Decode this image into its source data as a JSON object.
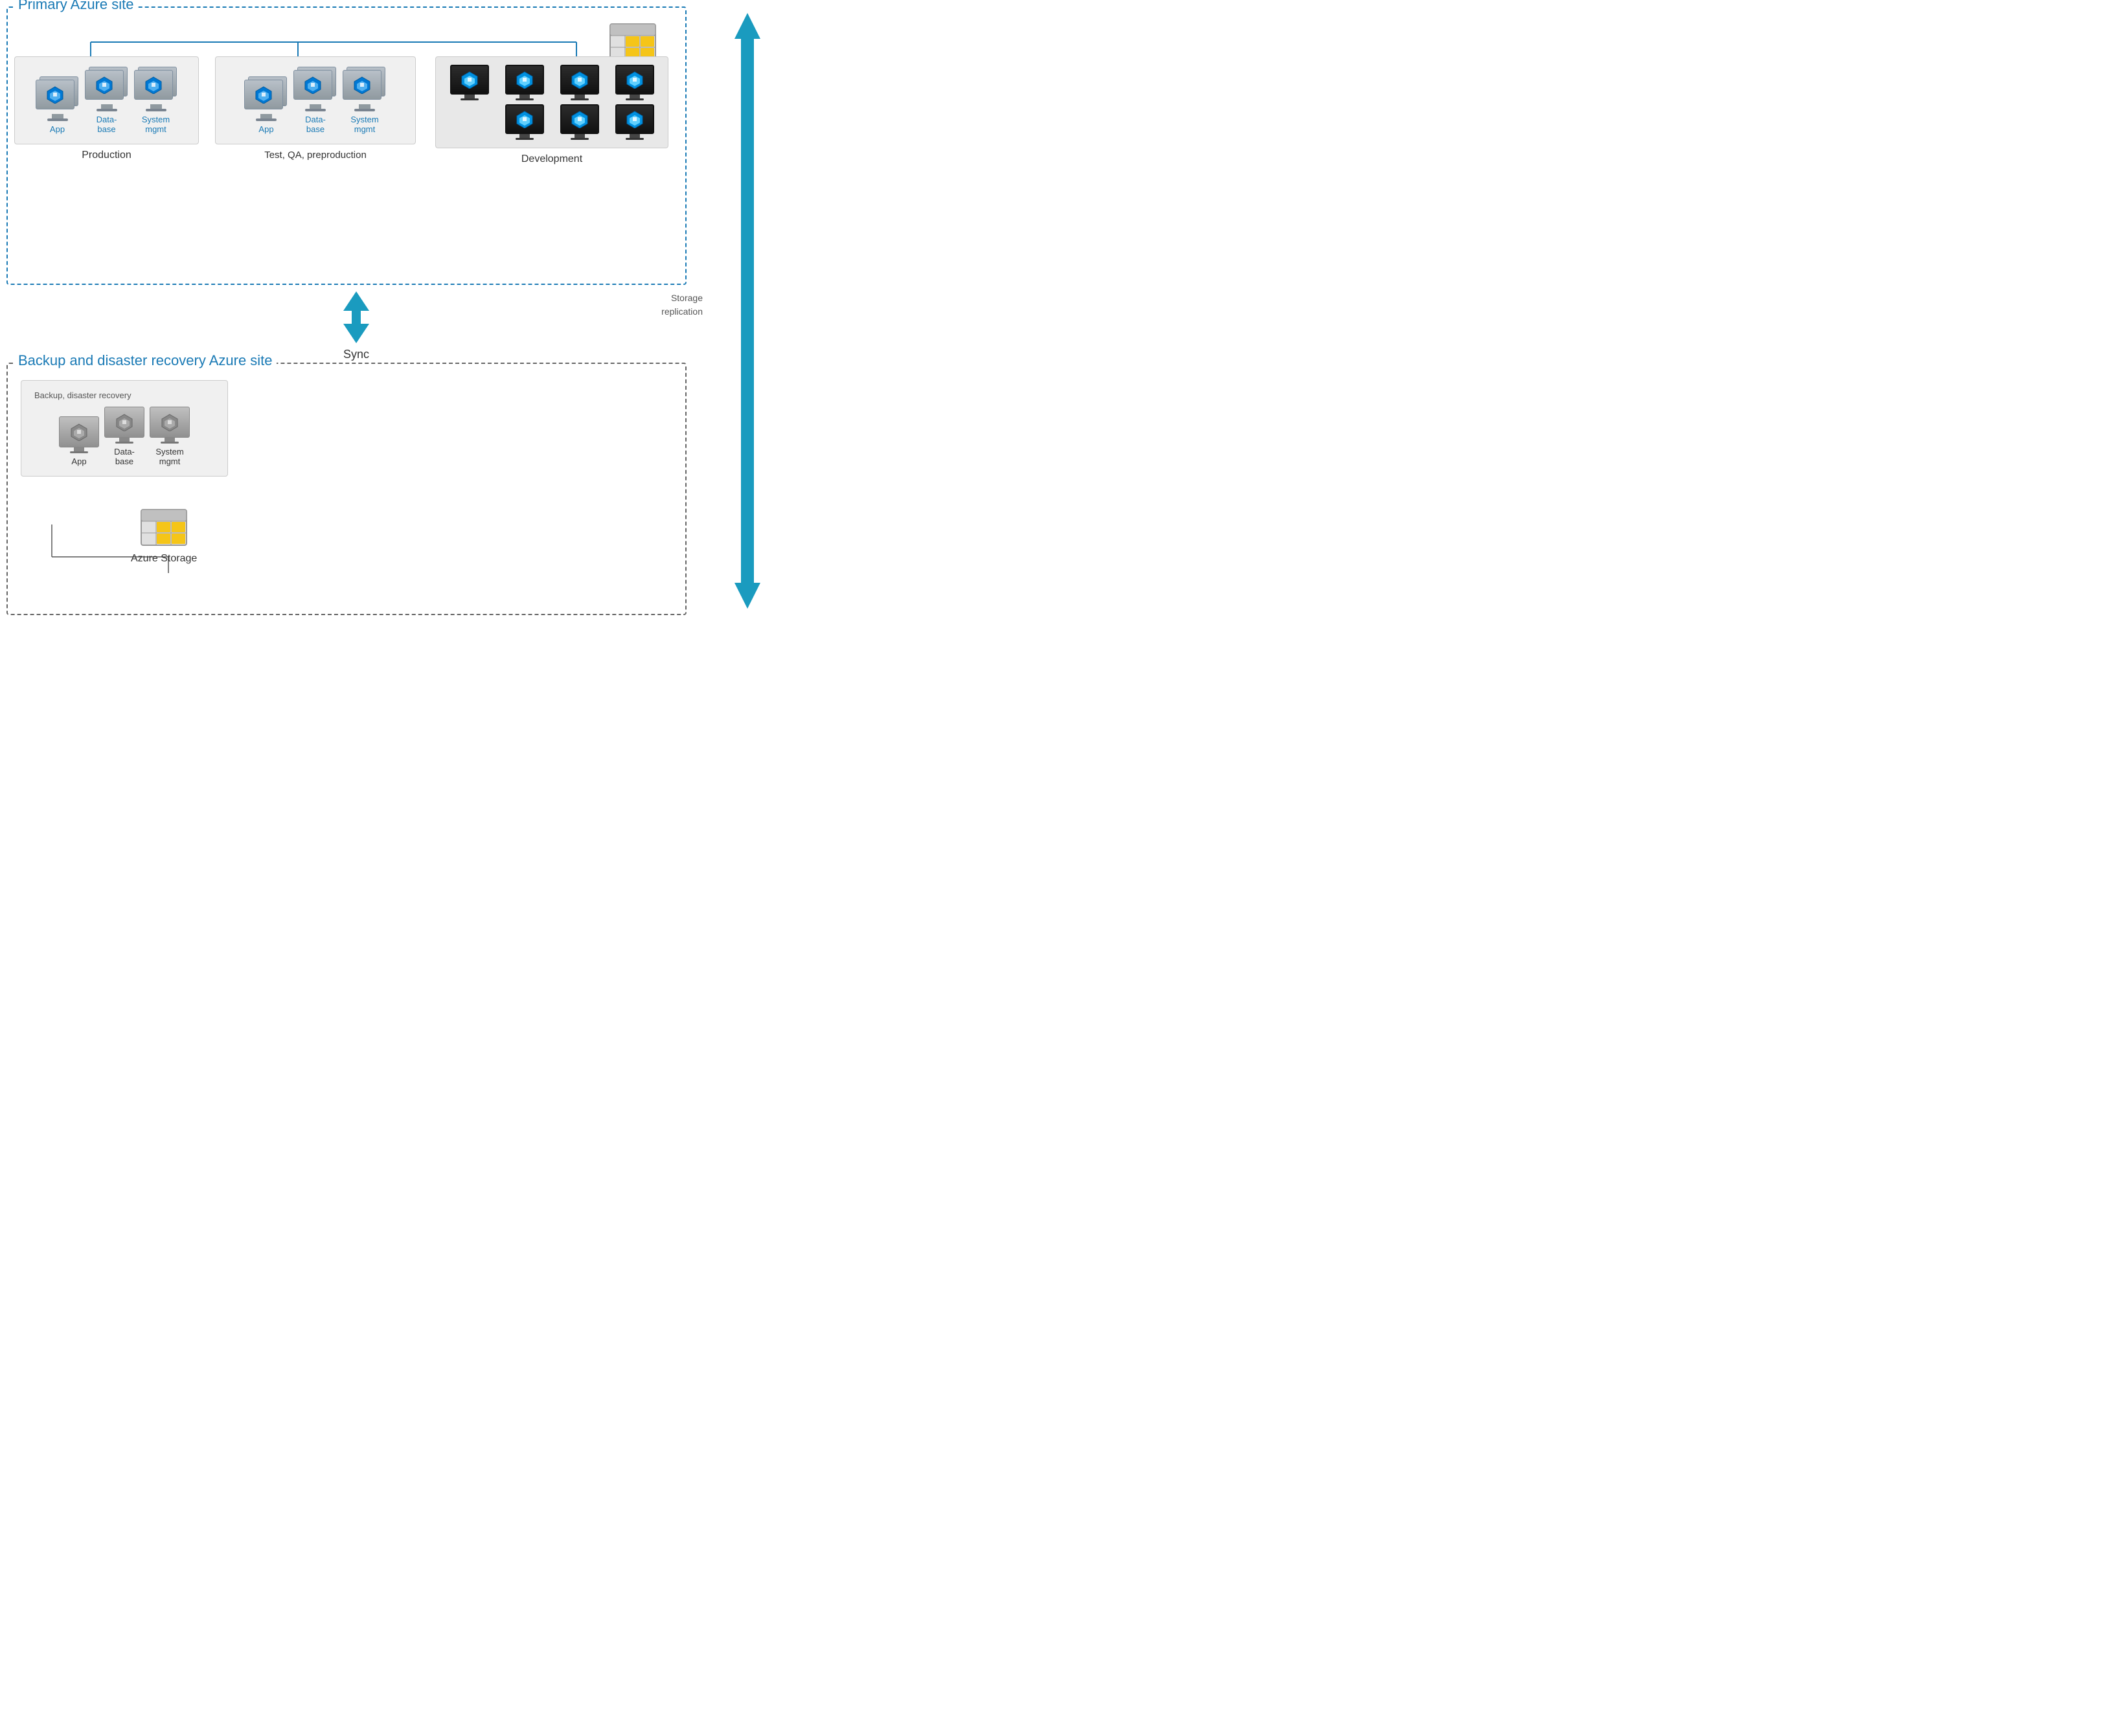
{
  "primarySite": {
    "label": "Primary Azure site"
  },
  "backupSite": {
    "label": "Backup and disaster recovery Azure site"
  },
  "storage": {
    "label": "Azure Storage"
  },
  "storageReplication": {
    "label": "Storage\nreplication"
  },
  "sync": {
    "label": "Sync"
  },
  "production": {
    "groupLabel": "Production",
    "vms": [
      {
        "label": "App"
      },
      {
        "label": "Data-\nbase"
      },
      {
        "label": "System\nmgmt"
      }
    ]
  },
  "testQA": {
    "groupLabel": "Test, QA, preproduction",
    "vms": [
      {
        "label": "App"
      },
      {
        "label": "Data-\nbase"
      },
      {
        "label": "System\nmgmt"
      }
    ]
  },
  "development": {
    "groupLabel": "Development",
    "vms": [
      {
        "label": ""
      },
      {
        "label": ""
      },
      {
        "label": ""
      },
      {
        "label": ""
      },
      {
        "label": ""
      },
      {
        "label": ""
      },
      {
        "label": ""
      }
    ]
  },
  "backupGroup": {
    "groupLabel": "Backup, disaster recovery",
    "vms": [
      {
        "label": "App"
      },
      {
        "label": "Data-\nbase"
      },
      {
        "label": "System\nmgmt"
      }
    ]
  }
}
